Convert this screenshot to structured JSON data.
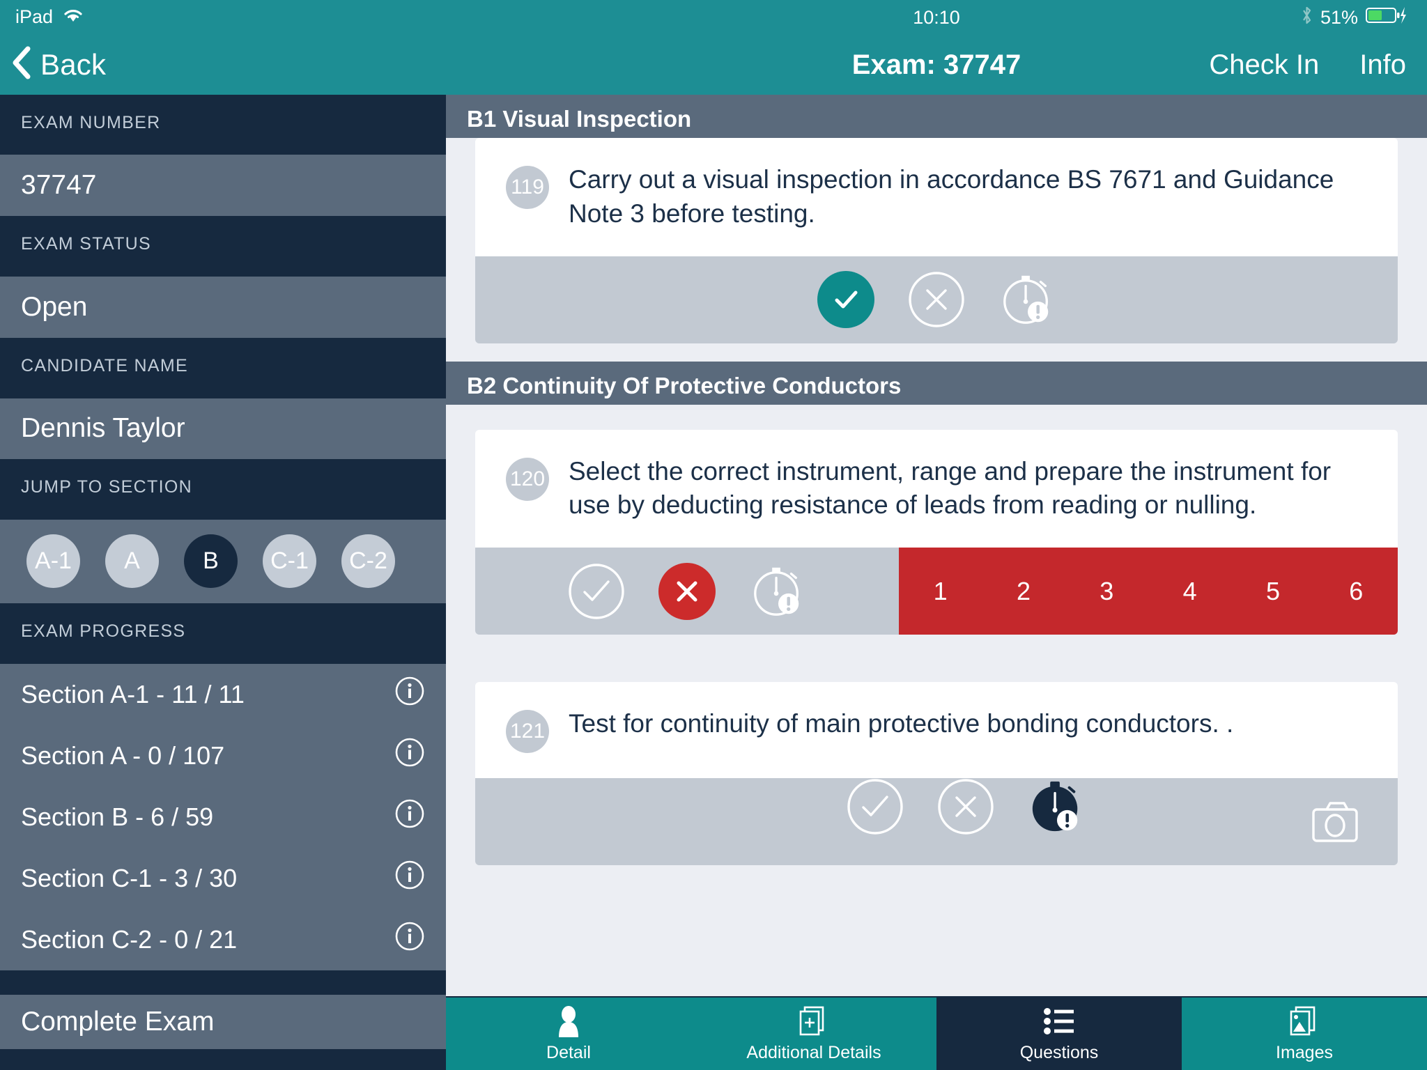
{
  "status_bar": {
    "device": "iPad",
    "wifi_icon": "wifi-icon",
    "time": "10:10",
    "bluetooth_icon": "bluetooth-icon",
    "battery_percent": "51%",
    "battery_icon": "battery-charging-icon"
  },
  "nav": {
    "back_label": "Back",
    "back_icon": "chevron-left-icon",
    "title": "Exam: 37747",
    "check_in_label": "Check In",
    "info_label": "Info"
  },
  "sidebar": {
    "fields": [
      {
        "label": "EXAM NUMBER",
        "value": "37747"
      },
      {
        "label": "EXAM STATUS",
        "value": "Open"
      },
      {
        "label": "CANDIDATE NAME",
        "value": "Dennis Taylor"
      }
    ],
    "jump_label": "JUMP TO SECTION",
    "pills": [
      {
        "label": "A-1",
        "active": false
      },
      {
        "label": "A",
        "active": false
      },
      {
        "label": "B",
        "active": true
      },
      {
        "label": "C-1",
        "active": false
      },
      {
        "label": "C-2",
        "active": false
      }
    ],
    "progress_label": "EXAM PROGRESS",
    "progress": [
      {
        "text": "Section A-1 - 11 / 11",
        "icon": "info-icon"
      },
      {
        "text": "Section A - 0 / 107",
        "icon": "info-icon"
      },
      {
        "text": "Section B - 6 / 59",
        "icon": "info-icon"
      },
      {
        "text": "Section C-1 - 3 / 30",
        "icon": "info-icon"
      },
      {
        "text": "Section C-2 - 0 / 21",
        "icon": "info-icon"
      }
    ],
    "complete_label": "Complete Exam"
  },
  "sections": [
    {
      "header": "B1 Visual Inspection",
      "questions": [
        {
          "number": "119",
          "text": "Carry out a visual inspection in accordance BS 7671 and Guidance Note 3  before testing.",
          "answers": {
            "tick": "selected",
            "cross": "unselected",
            "timer": "unselected"
          },
          "score_strip": null,
          "camera": false
        }
      ]
    },
    {
      "header": "B2 Continuity Of Protective Conductors",
      "questions": [
        {
          "number": "120",
          "text": "Select the correct instrument, range and prepare the instrument for use by deducting resistance of leads from reading or nulling.",
          "answers": {
            "tick": "unselected",
            "cross": "selected",
            "timer": "unselected"
          },
          "score_strip": [
            "1",
            "2",
            "3",
            "4",
            "5",
            "6"
          ],
          "camera": false
        },
        {
          "number": "121",
          "text": "Test for continuity of main protective bonding conductors. .",
          "answers": {
            "tick": "unselected",
            "cross": "unselected",
            "timer": "selected"
          },
          "score_strip": null,
          "camera": true
        }
      ]
    }
  ],
  "tabs": [
    {
      "label": "Detail",
      "icon": "person-icon",
      "active": false
    },
    {
      "label": "Additional Details",
      "icon": "document-plus-icon",
      "active": false
    },
    {
      "label": "Questions",
      "icon": "list-icon",
      "active": true
    },
    {
      "label": "Images",
      "icon": "photo-icon",
      "active": false
    }
  ],
  "colors": {
    "teal": "#0d8b8b",
    "nav_teal": "#1d8e94",
    "navy": "#16293f",
    "slate": "#5a6a7c",
    "answer_bar": "#c2c9d2",
    "red": "#c4282c",
    "selected_red": "#cc2b2b"
  }
}
